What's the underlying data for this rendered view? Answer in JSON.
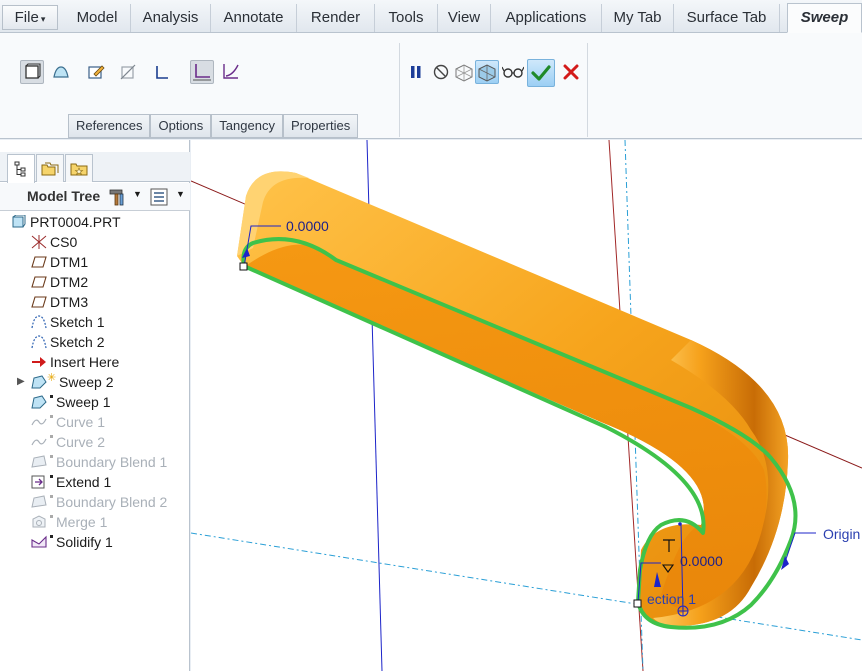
{
  "menubar": {
    "file_label": "File",
    "tabs": [
      "Model",
      "Analysis",
      "Annotate",
      "Render",
      "Tools",
      "View",
      "Applications",
      "My Tab",
      "Surface Tab"
    ],
    "active_tab": "Sweep"
  },
  "ribbon": {
    "panel_tabs": [
      "References",
      "Options",
      "Tangency",
      "Properties"
    ],
    "icons_left": [
      "solid-sweep-icon",
      "surface-sweep-icon",
      "sketch-icon",
      "remove-material-icon",
      "thicken-icon"
    ],
    "icons_mode": [
      "constant-section-icon",
      "variable-section-icon"
    ],
    "icons_right": [
      "pause-icon",
      "no-preview-icon",
      "attached-preview-icon",
      "feature-preview-icon",
      "verify-glasses-icon",
      "ok-check-icon",
      "cancel-x-icon"
    ]
  },
  "model_tree": {
    "title": "Model Tree",
    "items": [
      {
        "label": "PRT0004.PRT",
        "icon": "part-icon",
        "dim": false
      },
      {
        "label": "CS0",
        "icon": "csys-icon",
        "dim": false
      },
      {
        "label": "DTM1",
        "icon": "datum-plane-icon",
        "dim": false
      },
      {
        "label": "DTM2",
        "icon": "datum-plane-icon",
        "dim": false
      },
      {
        "label": "DTM3",
        "icon": "datum-plane-icon",
        "dim": false
      },
      {
        "label": "Sketch 1",
        "icon": "sketch-curve-icon",
        "dim": false
      },
      {
        "label": "Sketch 2",
        "icon": "sketch-curve-icon",
        "dim": false
      },
      {
        "label": "Insert Here",
        "icon": "insert-arrow-icon",
        "dim": false
      },
      {
        "label": "Sweep 2",
        "icon": "sweep-icon",
        "dim": false
      },
      {
        "label": "Sweep 1",
        "icon": "sweep-icon",
        "dim": false
      },
      {
        "label": "Curve 1",
        "icon": "curve-icon",
        "dim": true
      },
      {
        "label": "Curve 2",
        "icon": "curve-icon",
        "dim": true
      },
      {
        "label": "Boundary Blend 1",
        "icon": "boundary-blend-icon",
        "dim": true
      },
      {
        "label": "Extend 1",
        "icon": "extend-icon",
        "dim": false
      },
      {
        "label": "Boundary Blend 2",
        "icon": "boundary-blend-icon",
        "dim": true
      },
      {
        "label": "Merge 1",
        "icon": "merge-icon",
        "dim": true
      },
      {
        "label": "Solidify 1",
        "icon": "solidify-icon",
        "dim": false
      }
    ]
  },
  "viewport": {
    "dim_top": "0.0000",
    "dim_bottom": "0.0000",
    "section_label": "ection 1",
    "origin_label": "Origin",
    "sweep_color": "#f39a12",
    "edge_color": "#3fc24a"
  }
}
